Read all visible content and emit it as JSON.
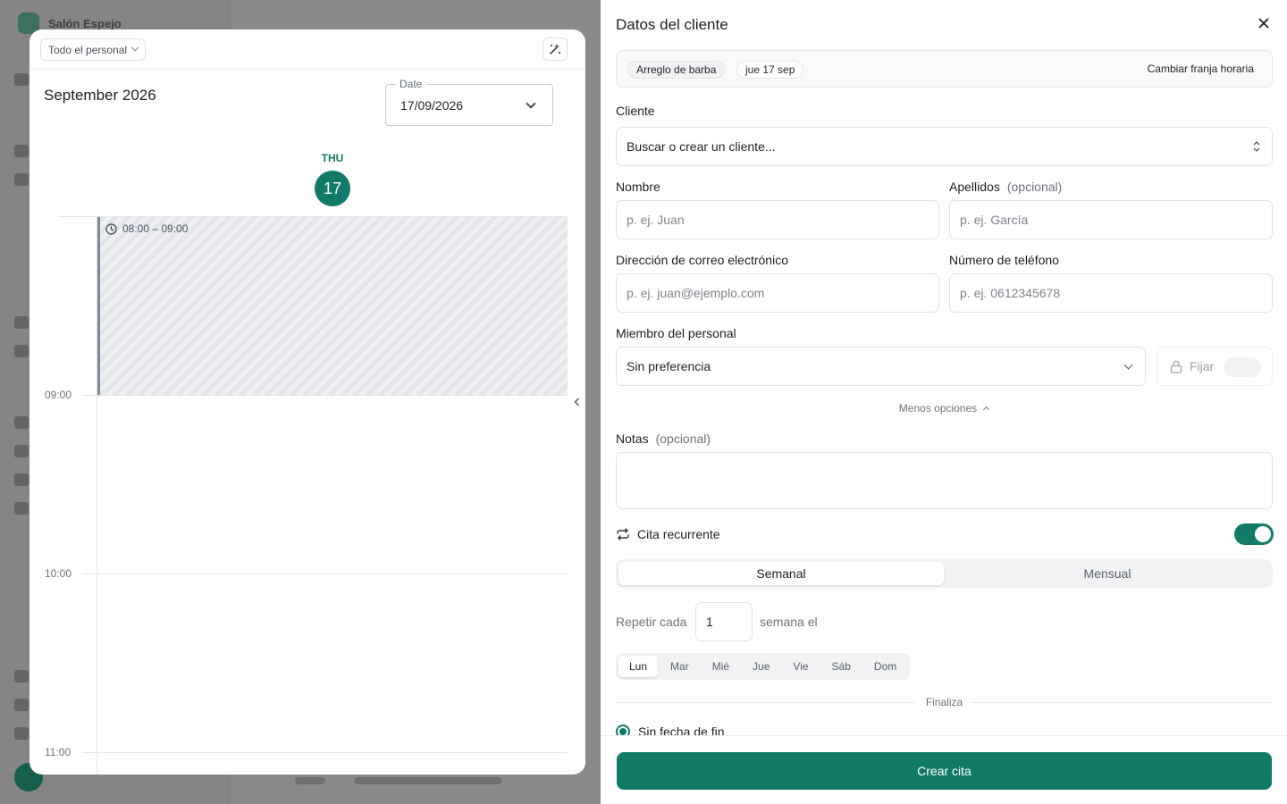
{
  "background": {
    "salon_name": "Salón Espejo"
  },
  "calendar": {
    "staff_filter": "Todo el personal",
    "month_title": "September 2026",
    "date_field": {
      "legend": "Date",
      "value": "17/09/2026"
    },
    "day": {
      "weekday": "THU",
      "number": "17"
    },
    "hours": [
      "09:00",
      "10:00",
      "11:00"
    ],
    "selected_slot": "08:00 – 09:00",
    "accent_color": "#127a68"
  },
  "drawer": {
    "title": "Datos del cliente",
    "summary": {
      "service": "Arreglo de barba",
      "date": "jue 17 sep",
      "change_slot": "Cambiar franja horaria"
    },
    "client": {
      "label": "Cliente",
      "placeholder": "Buscar o crear un cliente..."
    },
    "first_name": {
      "label": "Nombre",
      "placeholder": "p. ej. Juan"
    },
    "last_name": {
      "label": "Apellidos",
      "optional": "(opcional)",
      "placeholder": "p. ej. García"
    },
    "email": {
      "label": "Dirección de correo electrónico",
      "placeholder": "p. ej. juan@ejemplo.com"
    },
    "phone": {
      "label": "Número de teléfono",
      "placeholder": "p. ej. 0612345678"
    },
    "staff": {
      "label": "Miembro del personal",
      "value": "Sin preferencia",
      "pin_label": "Fijar",
      "pin_on": false
    },
    "less_options": "Menos opciones",
    "notes": {
      "label": "Notas",
      "optional": "(opcional)",
      "value": ""
    },
    "recurring": {
      "label": "Cita recurrente",
      "enabled": true,
      "tabs": [
        "Semanal",
        "Mensual"
      ],
      "active_tab": "Semanal",
      "repeat_prefix": "Repetir cada",
      "repeat_value": "1",
      "repeat_suffix": "semana el",
      "days": [
        "Lun",
        "Mar",
        "Mié",
        "Jue",
        "Vie",
        "Sáb",
        "Dom"
      ],
      "active_day": "Lun",
      "ends_label": "Finaliza",
      "end_option": "Sin fecha de fin"
    },
    "submit": "Crear cita"
  }
}
